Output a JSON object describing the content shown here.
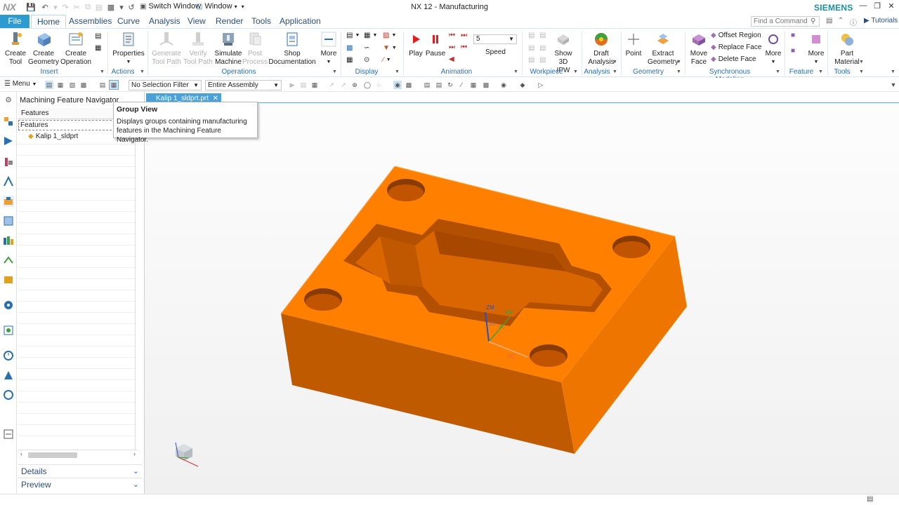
{
  "title_bar": {
    "logo": "NX",
    "switch_window": "Switch Window",
    "window_menu": "Window",
    "app_title": "NX 12 - Manufacturing",
    "brand": "SIEMENS"
  },
  "tabs": {
    "file": "File",
    "items": [
      "Home",
      "Assemblies",
      "Curve",
      "Analysis",
      "View",
      "Render",
      "Tools",
      "Application"
    ],
    "active": "Home",
    "search_placeholder": "Find a Command",
    "tutorials": "Tutorials"
  },
  "ribbon": {
    "insert": {
      "create_tool": [
        "Create",
        "Tool"
      ],
      "create_geometry": [
        "Create",
        "Geometry"
      ],
      "create_operation": [
        "Create",
        "Operation"
      ],
      "group": "Insert"
    },
    "actions": {
      "properties": "Properties",
      "group": "Actions"
    },
    "operations": {
      "generate": [
        "Generate",
        "Tool Path"
      ],
      "verify": [
        "Verify",
        "Tool Path"
      ],
      "simulate": [
        "Simulate",
        "Machine"
      ],
      "post": [
        "Post",
        "Process"
      ],
      "shop_doc": [
        "Shop",
        "Documentation"
      ],
      "more": "More",
      "group": "Operations"
    },
    "display": {
      "group": "Display"
    },
    "animation": {
      "play": "Play",
      "pause": "Pause",
      "speed_value": "5",
      "speed": "Speed",
      "group": "Animation"
    },
    "workpiece": {
      "show_ipw": [
        "Show 3D",
        "IPW"
      ],
      "group": "Workpiece"
    },
    "analysis": {
      "draft": [
        "Draft",
        "Analysis"
      ],
      "group": "Analysis"
    },
    "geometry": {
      "point": "Point",
      "extract": [
        "Extract",
        "Geometry"
      ],
      "group": "Geometry"
    },
    "sync": {
      "move_face": [
        "Move",
        "Face"
      ],
      "offset_region": "Offset Region",
      "replace_face": "Replace Face",
      "delete_face": "Delete Face",
      "more": "More",
      "group": "Synchronous Modeling"
    },
    "feature": {
      "more": "More",
      "group": "Feature"
    },
    "tools": {
      "part_material": [
        "Part",
        "Material"
      ],
      "group": "Tools"
    }
  },
  "toolbar2": {
    "menu": "Menu",
    "selection_filter": "No Selection Filter",
    "assembly_scope": "Entire Assembly"
  },
  "navigator": {
    "title": "Machining Feature Navigator",
    "column_header": "Features",
    "group_node": "Features",
    "items": [
      "Kalip 1_sldprt"
    ],
    "details": "Details",
    "preview": "Preview"
  },
  "viewport": {
    "doc_tab": "Kalip 1_sldprt.prt",
    "part_color": "#ff8000",
    "triad": {
      "zm": "ZM",
      "ym": "YM",
      "xm": "XC",
      "zc": "ZC",
      "yc": "YC"
    }
  },
  "tooltip": {
    "title": "Group View",
    "body_line1": "Displays groups containing manufacturing",
    "body_line2": "features in the Machining Feature Navigator."
  }
}
